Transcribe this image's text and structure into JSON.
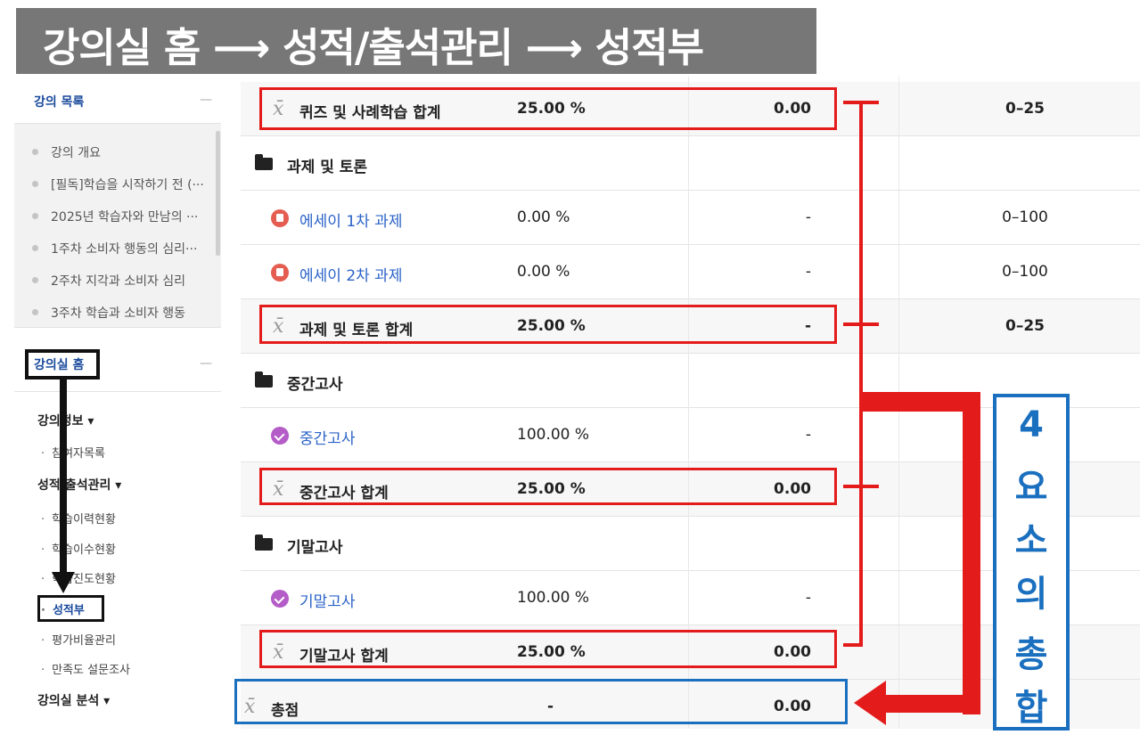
{
  "banner": {
    "title": "강의실 홈 ⟶ 성적/출석관리 ⟶ 성적부"
  },
  "sidebar": {
    "course_list_header": "강의 목록",
    "collapse_symbol": "—",
    "course_items": [
      "강의 개요",
      "[필독]학습을 시작하기 전 (···",
      "2025년 학습자와 만남의 ···",
      "1주차 소비자 행동의 심리···",
      "2주차 지각과 소비자 심리",
      "3주차 학습과 소비자 행동"
    ],
    "home_header": "강의실 홈",
    "sections": [
      {
        "label": "강의정보 ▾",
        "items": [
          "참여자목록"
        ]
      },
      {
        "label": "성적/출석관리 ▾",
        "items": [
          "학습이력현황",
          "학습이수현황",
          "학습진도현황",
          "성적부",
          "평가비율관리",
          "만족도 설문조사"
        ]
      },
      {
        "label": "강의실 분석 ▾",
        "items": []
      }
    ]
  },
  "grades": {
    "rows": [
      {
        "type": "total",
        "name": "퀴즈 및 사례학습 합계",
        "weight": "25.00 %",
        "grade": "0.00",
        "range": "0–25",
        "bold": true
      },
      {
        "type": "category",
        "name": "과제 및 토론"
      },
      {
        "type": "assign",
        "name": "에세이 1차 과제",
        "weight": "0.00 %",
        "grade": "-",
        "range": "0–100"
      },
      {
        "type": "assign",
        "name": "에세이 2차 과제",
        "weight": "0.00 %",
        "grade": "-",
        "range": "0–100"
      },
      {
        "type": "total",
        "name": "과제 및 토론 합계",
        "weight": "25.00 %",
        "grade": "-",
        "range": "0–25",
        "bold": true
      },
      {
        "type": "category",
        "name": "중간고사"
      },
      {
        "type": "quiz",
        "name": "중간고사",
        "weight": "100.00 %",
        "grade": "-",
        "range": ""
      },
      {
        "type": "total",
        "name": "중간고사 합계",
        "weight": "25.00 %",
        "grade": "0.00",
        "range": "",
        "bold": true
      },
      {
        "type": "category",
        "name": "기말고사"
      },
      {
        "type": "quiz",
        "name": "기말고사",
        "weight": "100.00 %",
        "grade": "-",
        "range": ""
      },
      {
        "type": "total",
        "name": "기말고사 합계",
        "weight": "25.00 %",
        "grade": "0.00",
        "range": "",
        "bold": true
      },
      {
        "type": "course-total",
        "name": "총점",
        "weight": "-",
        "grade": "0.00",
        "range": "",
        "bold": true
      }
    ]
  },
  "annotation": {
    "label_chars": [
      "4",
      "요",
      "소",
      "의",
      "총",
      "합"
    ],
    "colors": {
      "red": "#e41b1b",
      "blue": "#1a6fbf",
      "banner": "#777777"
    }
  }
}
